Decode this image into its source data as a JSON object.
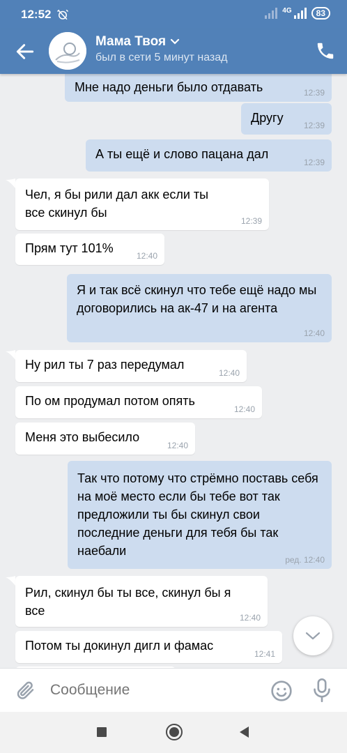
{
  "status_bar": {
    "time": "12:52",
    "network": "4G",
    "battery": "83"
  },
  "header": {
    "name": "Мама Твоя",
    "status": "был в сети 5 минут назад"
  },
  "messages": [
    {
      "dir": "out",
      "text": "Мне надо деньги было отдавать",
      "time": "12:39"
    },
    {
      "dir": "out",
      "text": "Другу",
      "time": "12:39"
    },
    {
      "dir": "out",
      "text": "А ты ещё и слово пацана дал",
      "time": "12:39"
    },
    {
      "dir": "in",
      "text": "Чел, я бы рили дал акк если ты все скинул бы",
      "time": "12:39"
    },
    {
      "dir": "in",
      "text": "Прям тут 101%",
      "time": "12:40"
    },
    {
      "dir": "out",
      "text": "Я и так всё скинул что тебе ещё надо мы договорились на ак-47 и на агента",
      "time": "12:40"
    },
    {
      "dir": "in",
      "text": "Ну рил ты 7 раз передумал",
      "time": "12:40"
    },
    {
      "dir": "in",
      "text": "По ом продумал потом опять",
      "time": "12:40"
    },
    {
      "dir": "in",
      "text": "Меня это выбесило",
      "time": "12:40"
    },
    {
      "dir": "out",
      "text": "Так что потому что стрёмно поставь себя на моё место если бы тебе вот так предложили ты бы скинул свои последние деньги для тебя бы так наебали",
      "time": "ред. 12:40"
    },
    {
      "dir": "in",
      "text": "Рил, скинул бы ты все, скинул бы я все",
      "time": "12:40"
    },
    {
      "dir": "in",
      "text": "Потом ты докинул дигл и фамас",
      "time": "12:41"
    }
  ],
  "composer": {
    "placeholder": "Сообщение"
  },
  "colors": {
    "header": "#5181b8",
    "outgoing_bubble": "#cddcef",
    "incoming_bubble": "#ffffff",
    "background": "#edeef0"
  },
  "icons": [
    "back-arrow-icon",
    "chevron-down-icon",
    "phone-icon",
    "attach-icon",
    "emoji-icon",
    "mic-icon",
    "scroll-down-icon"
  ]
}
